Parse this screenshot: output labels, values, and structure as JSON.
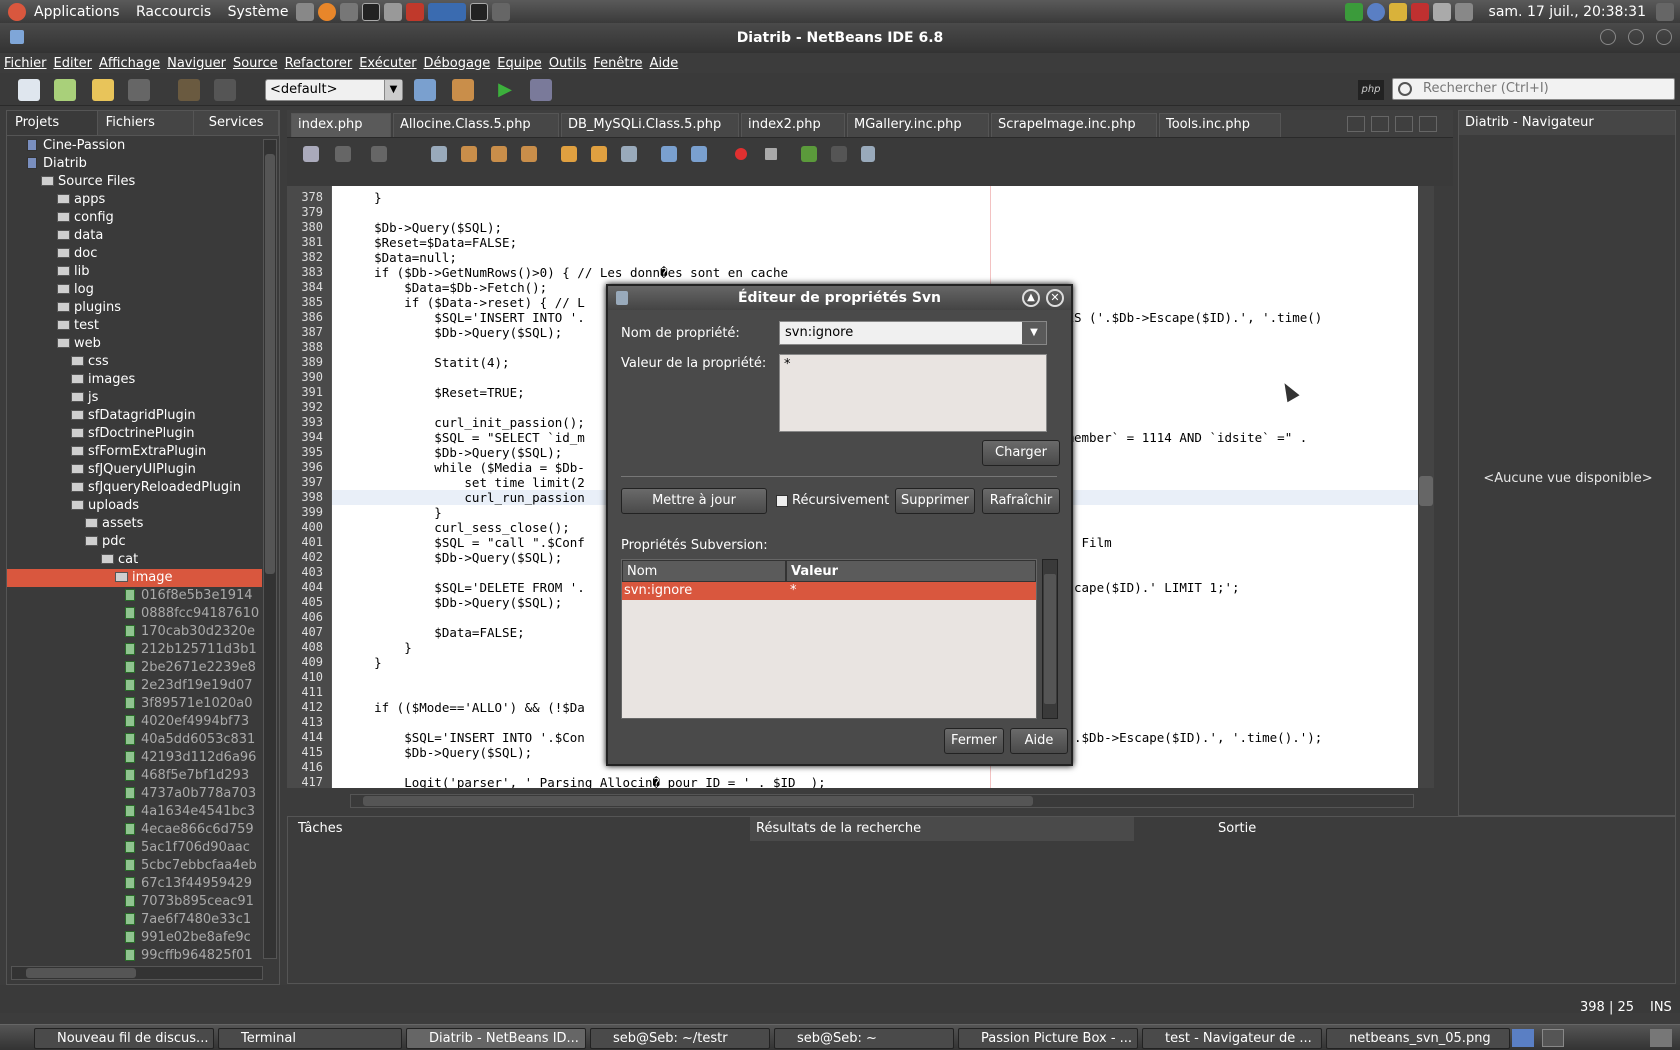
{
  "system": {
    "menus": [
      "Applications",
      "Raccourcis",
      "Système"
    ],
    "datetime": "sam. 17 juil., 20:38:31"
  },
  "window": {
    "title": "Diatrib - NetBeans IDE 6.8",
    "ghost_title": "Nouveau fil de discussion - Firefox"
  },
  "menubar": [
    "Fichier",
    "Editer",
    "Affichage",
    "Naviguer",
    "Source",
    "Refactorer",
    "Exécuter",
    "Débogage",
    "Equipe",
    "Outils",
    "Fenêtre",
    "Aide"
  ],
  "toolbar": {
    "config": "<default>",
    "search_placeholder": "Rechercher (Ctrl+I)"
  },
  "left_panel": {
    "tabs": [
      "Projets",
      "Fichiers",
      "Services"
    ],
    "tree": [
      "Cine-Passion",
      "Diatrib",
      "Source Files",
      "apps",
      "config",
      "data",
      "doc",
      "lib",
      "log",
      "plugins",
      "test",
      "web",
      "css",
      "images",
      "js",
      "sfDatagridPlugin",
      "sfDoctrinePlugin",
      "sfFormExtraPlugin",
      "sfJQueryUIPlugin",
      "sfJqueryReloadedPlugin",
      "uploads",
      "assets",
      "pdc",
      "cat",
      "image"
    ],
    "files": [
      "016f8e5b3e1914",
      "0888fcc94187610",
      "170cab30d2320e",
      "212b125711d3b1",
      "2be2671e2239e8",
      "2e23df19e19d07",
      "3f89571e1020a0",
      "4020ef4994bf73",
      "40a5dd6053c831",
      "42193d112d6a96",
      "468f5e7bf1d293",
      "4737a0b778a703",
      "4a1634e4541bc3",
      "4ecae866c6d759",
      "5ac1f706d90aac",
      "5cbc7ebbcfaa4eb",
      "67c13f44959429",
      "7073b895ceac91",
      "7ae6f7480e33c1",
      "991e02be8afe9c",
      "99cffb964825f01"
    ]
  },
  "editor_tabs": [
    "index.php",
    "Allocine.Class.5.php",
    "DB_MySQLi.Class.5.php",
    "index2.php",
    "MGallery.inc.php",
    "ScrapeImage.inc.php",
    "Tools.inc.php"
  ],
  "code": {
    "lines": [
      {
        "n": "378",
        "t": "    }"
      },
      {
        "n": "379",
        "t": ""
      },
      {
        "n": "380",
        "t": "    $Db->Query($SQL);"
      },
      {
        "n": "381",
        "t": "    $Reset=$Data=FALSE;"
      },
      {
        "n": "382",
        "t": "    $Data=null;"
      },
      {
        "n": "383",
        "t": "    if ($Db->GetNumRows()>0) { // Les donn�es sont en cache"
      },
      {
        "n": "384",
        "t": "        $Data=$Db->Fetch();"
      },
      {
        "n": "385",
        "t": "        if ($Data->reset) { // L"
      },
      {
        "n": "386",
        "t": "            $SQL='INSERT INTO '.                                                      `ce`) VALUES ('.$Db->Escape($ID).', '.time()"
      },
      {
        "n": "387",
        "t": "            $Db->Query($SQL);"
      },
      {
        "n": "388",
        "t": ""
      },
      {
        "n": "389",
        "t": "            Statit(4);"
      },
      {
        "n": "390",
        "t": ""
      },
      {
        "n": "391",
        "t": "            $Reset=TRUE;"
      },
      {
        "n": "392",
        "t": ""
      },
      {
        "n": "393",
        "t": "            curl_init_passion();"
      },
      {
        "n": "394",
        "t": "            $SQL = \"SELECT `id_m                                                      WHERE `id_member` = 1114 AND `idsite` =\" ."
      },
      {
        "n": "395",
        "t": "            $Db->Query($SQL);"
      },
      {
        "n": "396",
        "t": "            while ($Media = $Db-"
      },
      {
        "n": "397",
        "t": "                set time limit(2"
      },
      {
        "n": "398",
        "t": "                curl_run_passion"
      },
      {
        "n": "399",
        "t": "            }"
      },
      {
        "n": "400",
        "t": "            curl_sess_close();"
      },
      {
        "n": "401",
        "t": "            $SQL = \"call \".$Conf                                                      suppression Film"
      },
      {
        "n": "402",
        "t": "            $Db->Query($SQL);"
      },
      {
        "n": "403",
        "t": ""
      },
      {
        "n": "404",
        "t": "            $SQL='DELETE FROM '.                                                      = '.$Db->Escape($ID).' LIMIT 1;';"
      },
      {
        "n": "405",
        "t": "            $Db->Query($SQL);"
      },
      {
        "n": "406",
        "t": ""
      },
      {
        "n": "407",
        "t": "            $Data=FALSE;"
      },
      {
        "n": "408",
        "t": "        }"
      },
      {
        "n": "409",
        "t": "    }"
      },
      {
        "n": "410",
        "t": ""
      },
      {
        "n": "411",
        "t": ""
      },
      {
        "n": "412",
        "t": "    if (($Mode=='ALLO') && (!$Da"
      },
      {
        "n": "413",
        "t": ""
      },
      {
        "n": "414",
        "t": "        $SQL='INSERT INTO '.$Con                                                      ) VALUES ('.$Db->Escape($ID).', '.time().');"
      },
      {
        "n": "415",
        "t": "        $Db->Query($SQL);"
      },
      {
        "n": "416",
        "t": ""
      },
      {
        "n": "417",
        "t": "        Logit('parser', ' Parsing Allocin� pour ID = ' . $ID  );"
      }
    ]
  },
  "navigator": {
    "title": "Diatrib - Navigateur",
    "empty": "<Aucune vue disponible>"
  },
  "bottom_tabs": [
    "Tâches",
    "Résultats de la recherche",
    "Sortie"
  ],
  "status": {
    "position": "398 | 25",
    "mode": "INS"
  },
  "dialog": {
    "title": "Éditeur de propriétés Svn",
    "name_label": "Nom de propriété:",
    "name_value": "svn:ignore",
    "value_label": "Valeur de la propriété:",
    "value_text": "*",
    "load_button": "Charger",
    "update_button": "Mettre à jour",
    "recursive_label": "Récursivement",
    "delete_button": "Supprimer",
    "refresh_button": "Rafraîchir",
    "props_label": "Propriétés Subversion:",
    "columns": [
      "Nom",
      "Valeur"
    ],
    "rows": [
      {
        "name": "svn:ignore",
        "value": "*"
      }
    ],
    "close_button": "Fermer",
    "help_button": "Aide"
  },
  "taskbar": [
    "Nouveau fil de discus...",
    "Terminal",
    "Diatrib - NetBeans ID...",
    "seb@Seb: ~/testr",
    "seb@Seb: ~",
    "Passion Picture Box - ...",
    "test - Navigateur de ...",
    "netbeans_svn_05.png"
  ],
  "colors": {
    "accent": "#d9573e",
    "editor_bg": "#ffffff",
    "panel_bg": "#3c3c3c"
  }
}
